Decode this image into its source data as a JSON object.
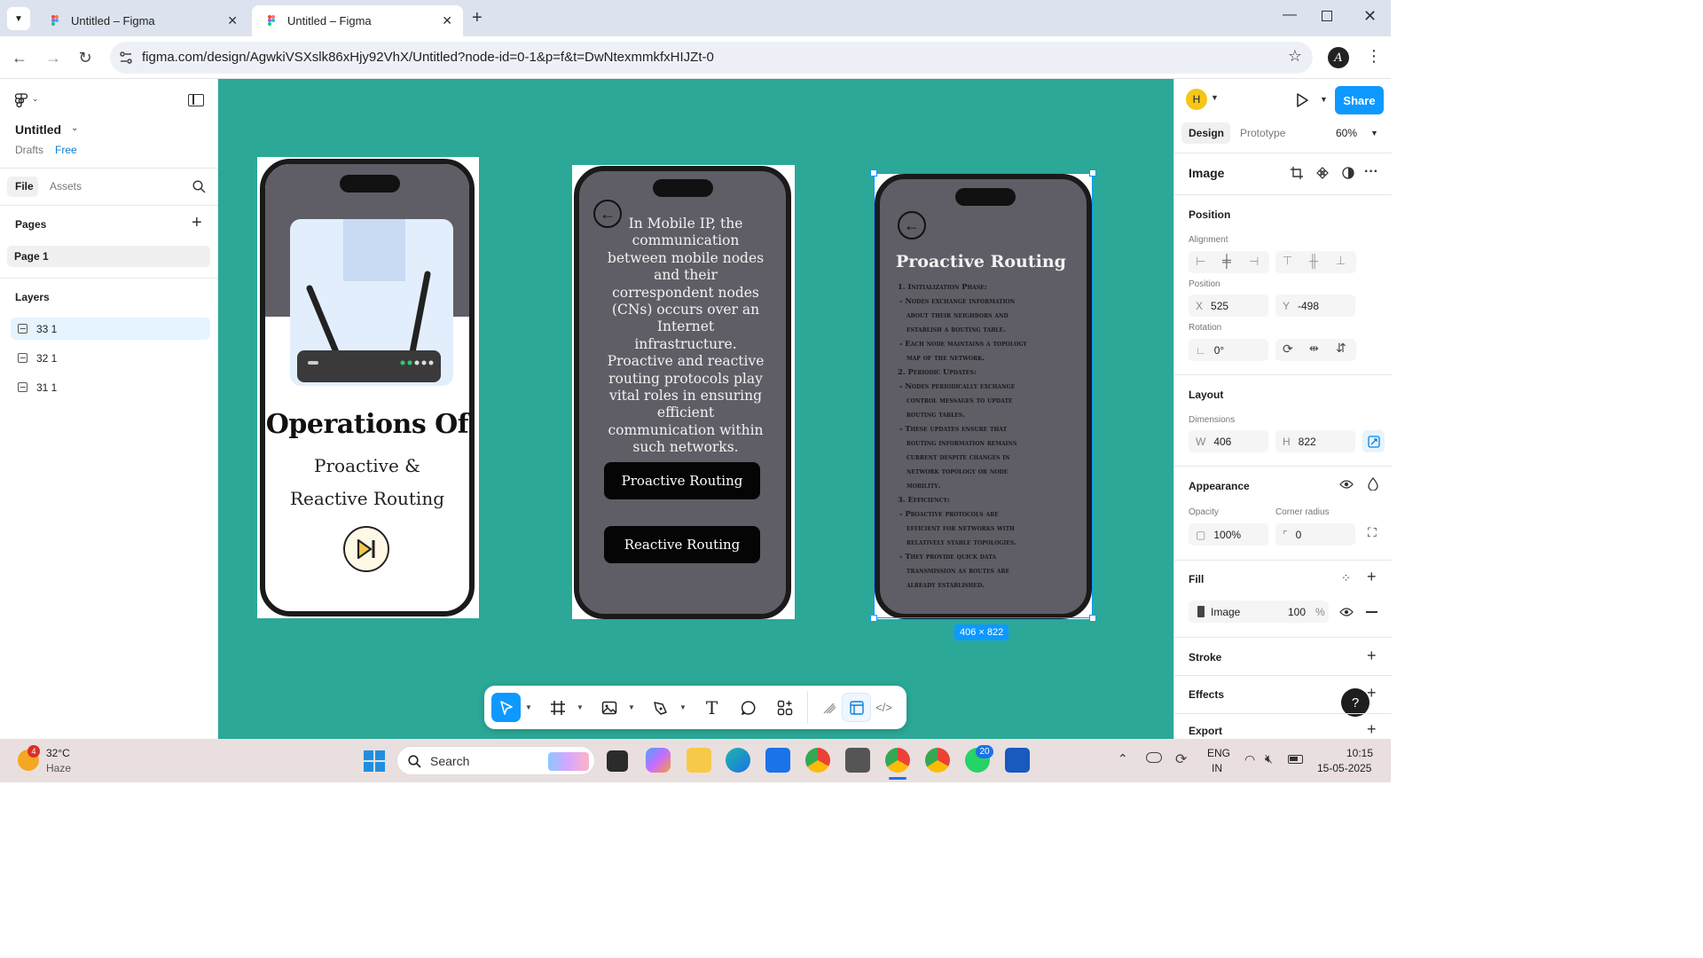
{
  "browser": {
    "tabs": [
      {
        "title": "Untitled – Figma",
        "active": false
      },
      {
        "title": "Untitled – Figma",
        "active": true
      }
    ],
    "url": "figma.com/design/AgwkiVSXslk86xHjy92VhX/Untitled?node-id=0-1&p=f&t=DwNtexmmkfxHIJZt-0"
  },
  "left_panel": {
    "file_name": "Untitled",
    "drafts": "Drafts",
    "plan": "Free",
    "tabs": [
      "File",
      "Assets"
    ],
    "pages_title": "Pages",
    "pages": [
      "Page 1"
    ],
    "layers_title": "Layers",
    "layers": [
      "33 1",
      "32 1",
      "31 1"
    ]
  },
  "canvas": {
    "background": "#2ba898",
    "selection_color": "#0d99ff",
    "frame1": {
      "title": "Operations Of",
      "subtitle": "Proactive & Reactive Routing"
    },
    "frame2": {
      "body": "In Mobile IP, the communication between mobile nodes and their correspondent nodes (CNs) occurs over an Internet infrastructure. Proactive and reactive routing protocols play vital roles in ensuring efficient communication within such networks.",
      "buttons": [
        "Proactive Routing",
        "Reactive Routing"
      ]
    },
    "frame3": {
      "title": "Proactive Routing",
      "lines": [
        "1. Initialization Phase:",
        "- Nodes exchange information",
        "about their neighbors and",
        "establish a routing table.",
        "- Each node maintains a topology",
        "map of the network.",
        "2. Periodic Updates:",
        "- Nodes periodically exchange",
        "control messages to update",
        "routing tables.",
        "- These updates ensure that",
        "routing information remains",
        "current despite changes in",
        "network topology or node",
        "mobility.",
        "3. Efficiency:",
        "- Proactive protocols are",
        "efficient for networks with",
        "relatively stable topologies.",
        "- They provide quick data",
        "transmission as routes are",
        "already established."
      ],
      "size_badge": "406 × 822"
    }
  },
  "right_panel": {
    "avatar_letter": "H",
    "share_label": "Share",
    "tabs": [
      "Design",
      "Prototype"
    ],
    "zoom": "60%",
    "selection_type": "Image",
    "position_title": "Position",
    "alignment_label": "Alignment",
    "position_label": "Position",
    "x_label": "X",
    "x_value": "525",
    "y_label": "Y",
    "y_value": "-498",
    "rotation_label": "Rotation",
    "rotation_value": "0°",
    "layout_title": "Layout",
    "dimensions_label": "Dimensions",
    "w_label": "W",
    "w_value": "406",
    "h_label": "H",
    "h_value": "822",
    "appearance_title": "Appearance",
    "opacity_label": "Opacity",
    "opacity_value": "100%",
    "corner_label": "Corner radius",
    "corner_value": "0",
    "fill_title": "Fill",
    "fill_type": "Image",
    "fill_opacity": "100",
    "fill_unit": "%",
    "stroke_title": "Stroke",
    "effects_title": "Effects",
    "export_title": "Export",
    "help": "?"
  },
  "taskbar": {
    "weather_badge": "4",
    "temperature": "32°C",
    "condition": "Haze",
    "search_placeholder": "Search",
    "whatsapp_badge": "20",
    "language": "ENG",
    "region": "IN",
    "time": "10:15",
    "date": "15-05-2025"
  }
}
